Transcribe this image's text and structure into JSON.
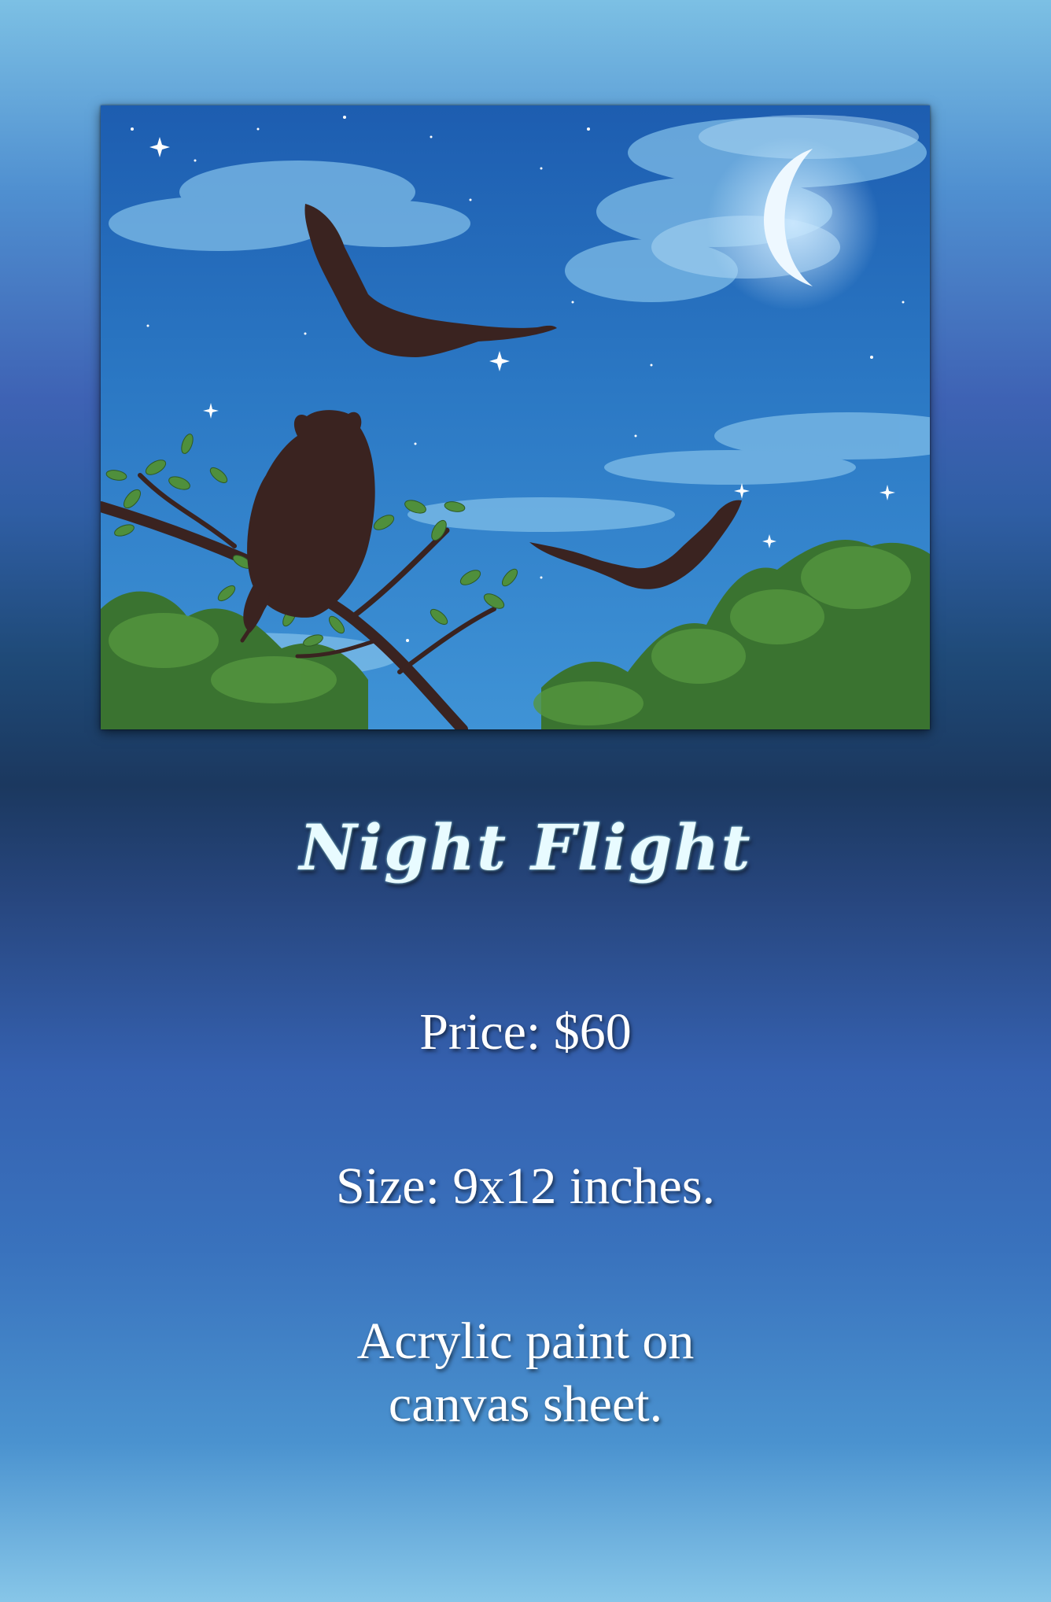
{
  "artwork": {
    "title": "Night Flight",
    "price_text": "Price: $60",
    "size_text": "Size: 9x12 inches.",
    "medium_line1": "Acrylic paint on",
    "medium_line2": "canvas sheet."
  },
  "colors": {
    "title_text": "#e8fbff",
    "body_text": "#ffffff",
    "sky": "#2f73bd",
    "owl": "#3a2320",
    "foliage": "#3e7a34"
  },
  "painting": {
    "subject_icons": [
      "night-sky",
      "crescent-moon",
      "stars",
      "owl-perched",
      "owl-flying",
      "tree-branch",
      "treeline"
    ]
  }
}
